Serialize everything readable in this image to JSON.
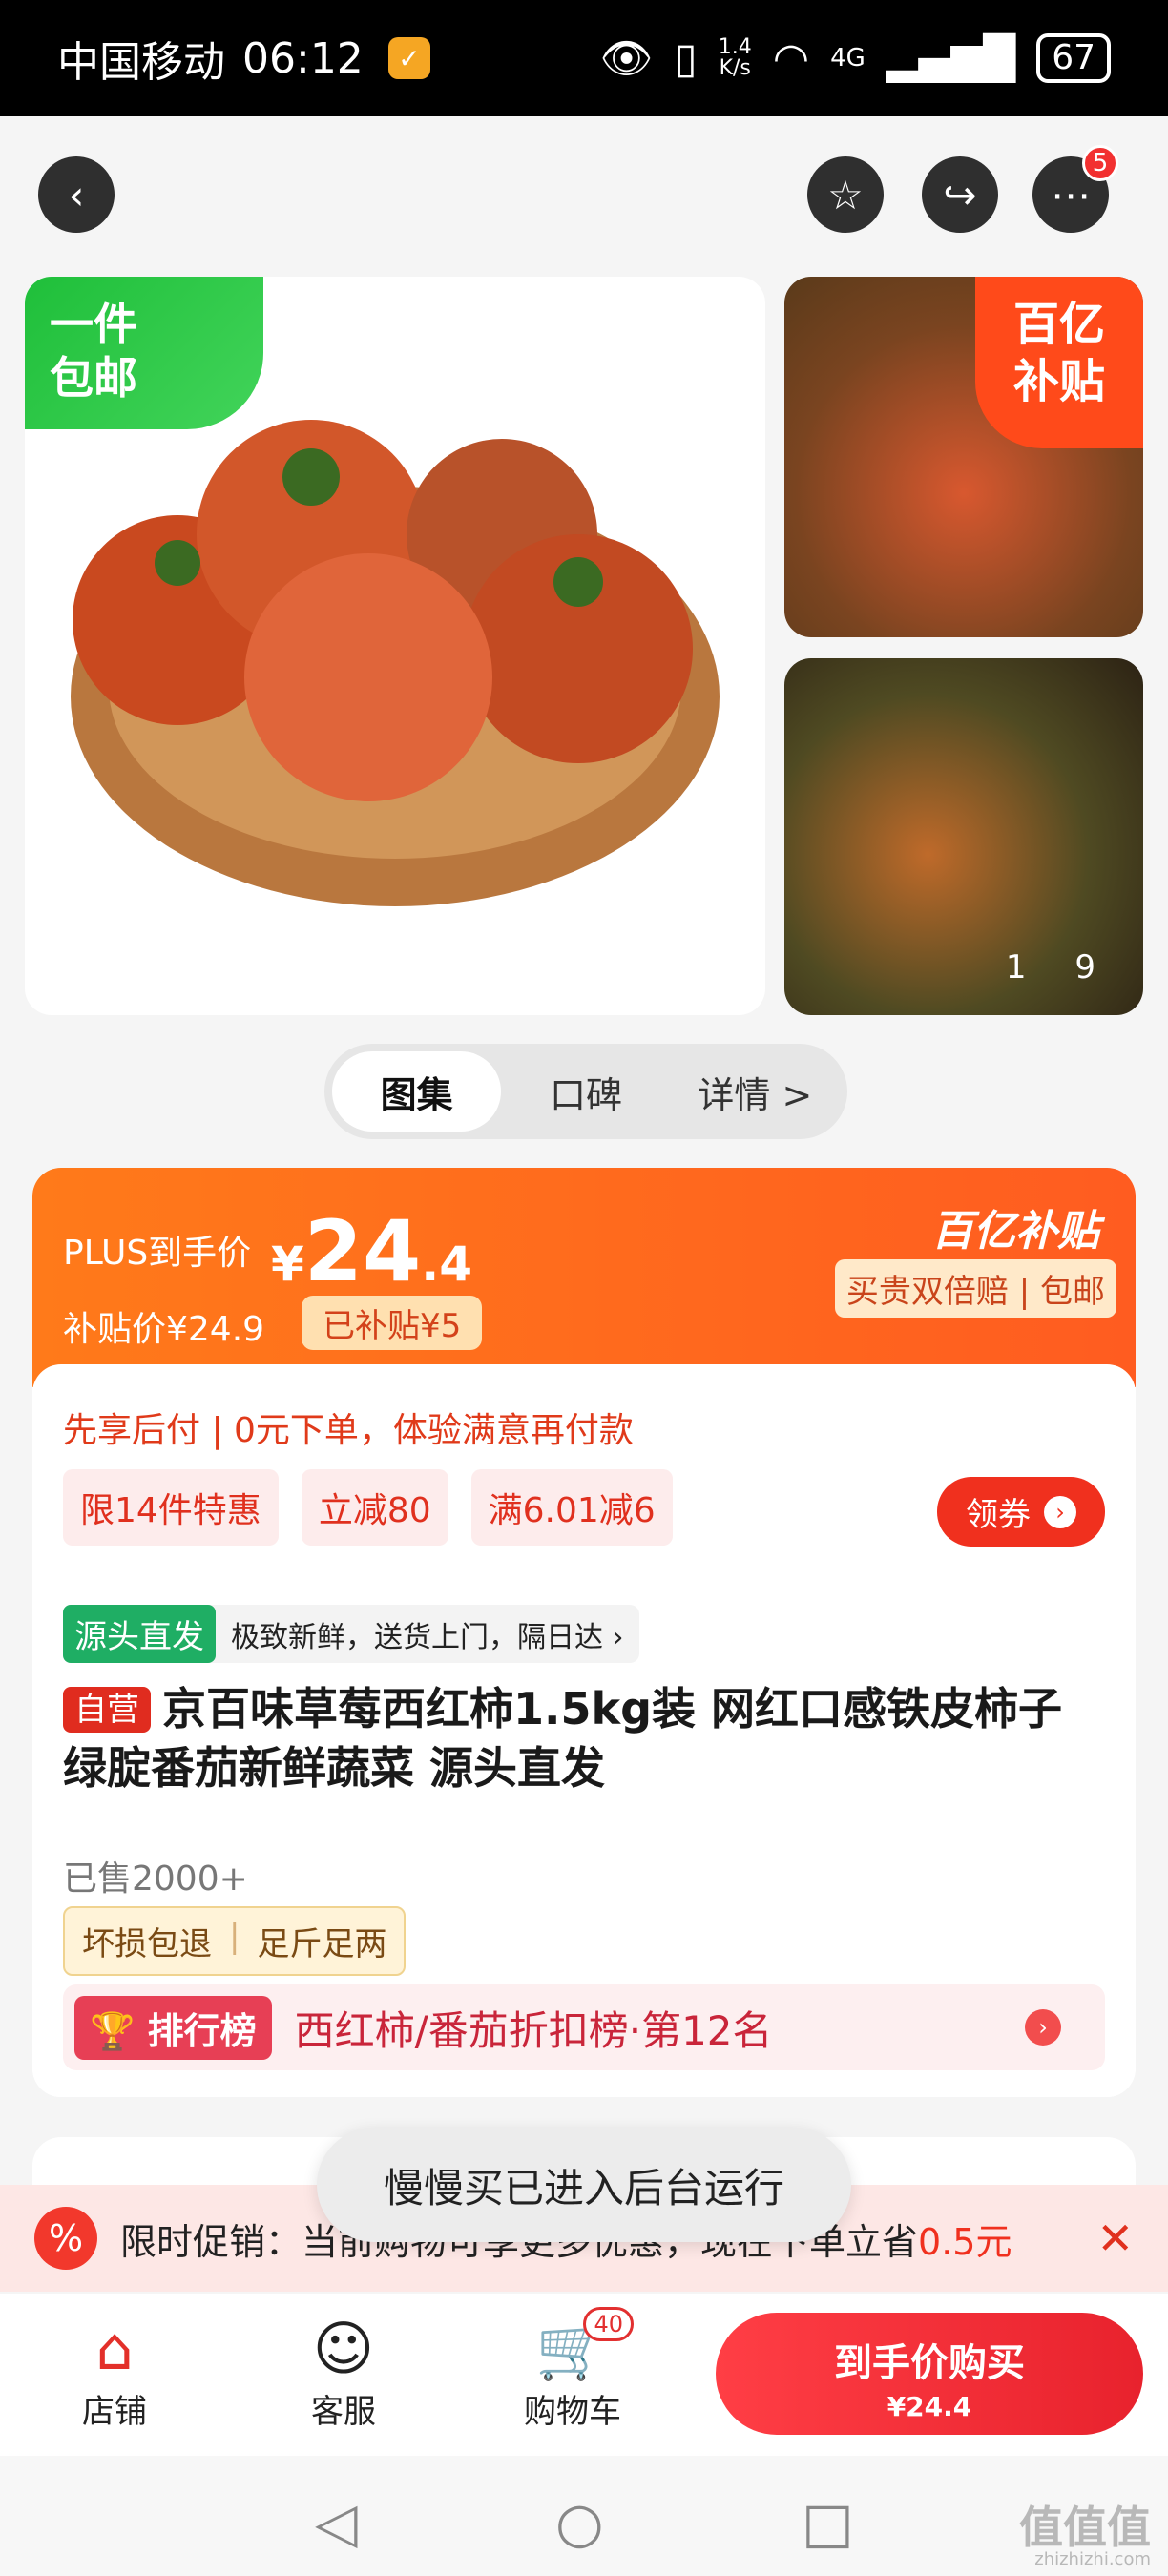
{
  "status": {
    "carrier": "中国移动",
    "time": "06:12",
    "speed_value": "1.4",
    "speed_unit": "K/s",
    "network": "4G",
    "battery": "67"
  },
  "header": {
    "more_badge": "5"
  },
  "gallery": {
    "main_tag": "一件\n包邮",
    "thumb_tag": "百亿\n补贴",
    "counter": "1 9"
  },
  "tabs": [
    {
      "label": "图集"
    },
    {
      "label": "口碑"
    },
    {
      "label": "详情 >"
    }
  ],
  "price": {
    "plus_label": "PLUS到手价",
    "currency": "¥",
    "integer": "24",
    "decimal": ".4",
    "subsidy_price": "补贴价¥24.9",
    "subsidized": "已补贴¥5",
    "brand": "百亿补贴",
    "brand_sub": "买贵双倍赔 | 包邮"
  },
  "product": {
    "paylater": "先享后付 | 0元下单，体验满意再付款",
    "chips": [
      "限14件特惠",
      "立减80",
      "满6.01减6"
    ],
    "coupon_label": "领券",
    "source_tag": "源头直发",
    "source_text": "极致新鲜，送货上门，隔日达 ›",
    "self_tag": "自营",
    "title": "京百味草莓西红柿1.5kg装 网红口感铁皮柿子绿腚番茄新鲜蔬菜 源头直发",
    "sold": "已售2000+",
    "guarantee_1": "坏损包退",
    "guarantee_2": "足斤足两",
    "rank_tag": "排行榜",
    "rank_text": "西红柿/番茄折扣榜·第12名"
  },
  "promo": {
    "label": "限时促销：当前购物可享更多优惠，现在下单立省",
    "amount": "0.5元"
  },
  "toast": "慢慢买已进入后台运行",
  "bottom": {
    "store": "店铺",
    "service": "客服",
    "cart": "购物车",
    "cart_badge": "40",
    "buy_label": "到手价购买",
    "buy_price": "¥24.4"
  },
  "watermark": {
    "mark": "值值值",
    "url": "zhizhizhi.com"
  },
  "colors": {
    "accent": "#ff5c20",
    "red": "#f0301e",
    "green": "#1fae64"
  }
}
